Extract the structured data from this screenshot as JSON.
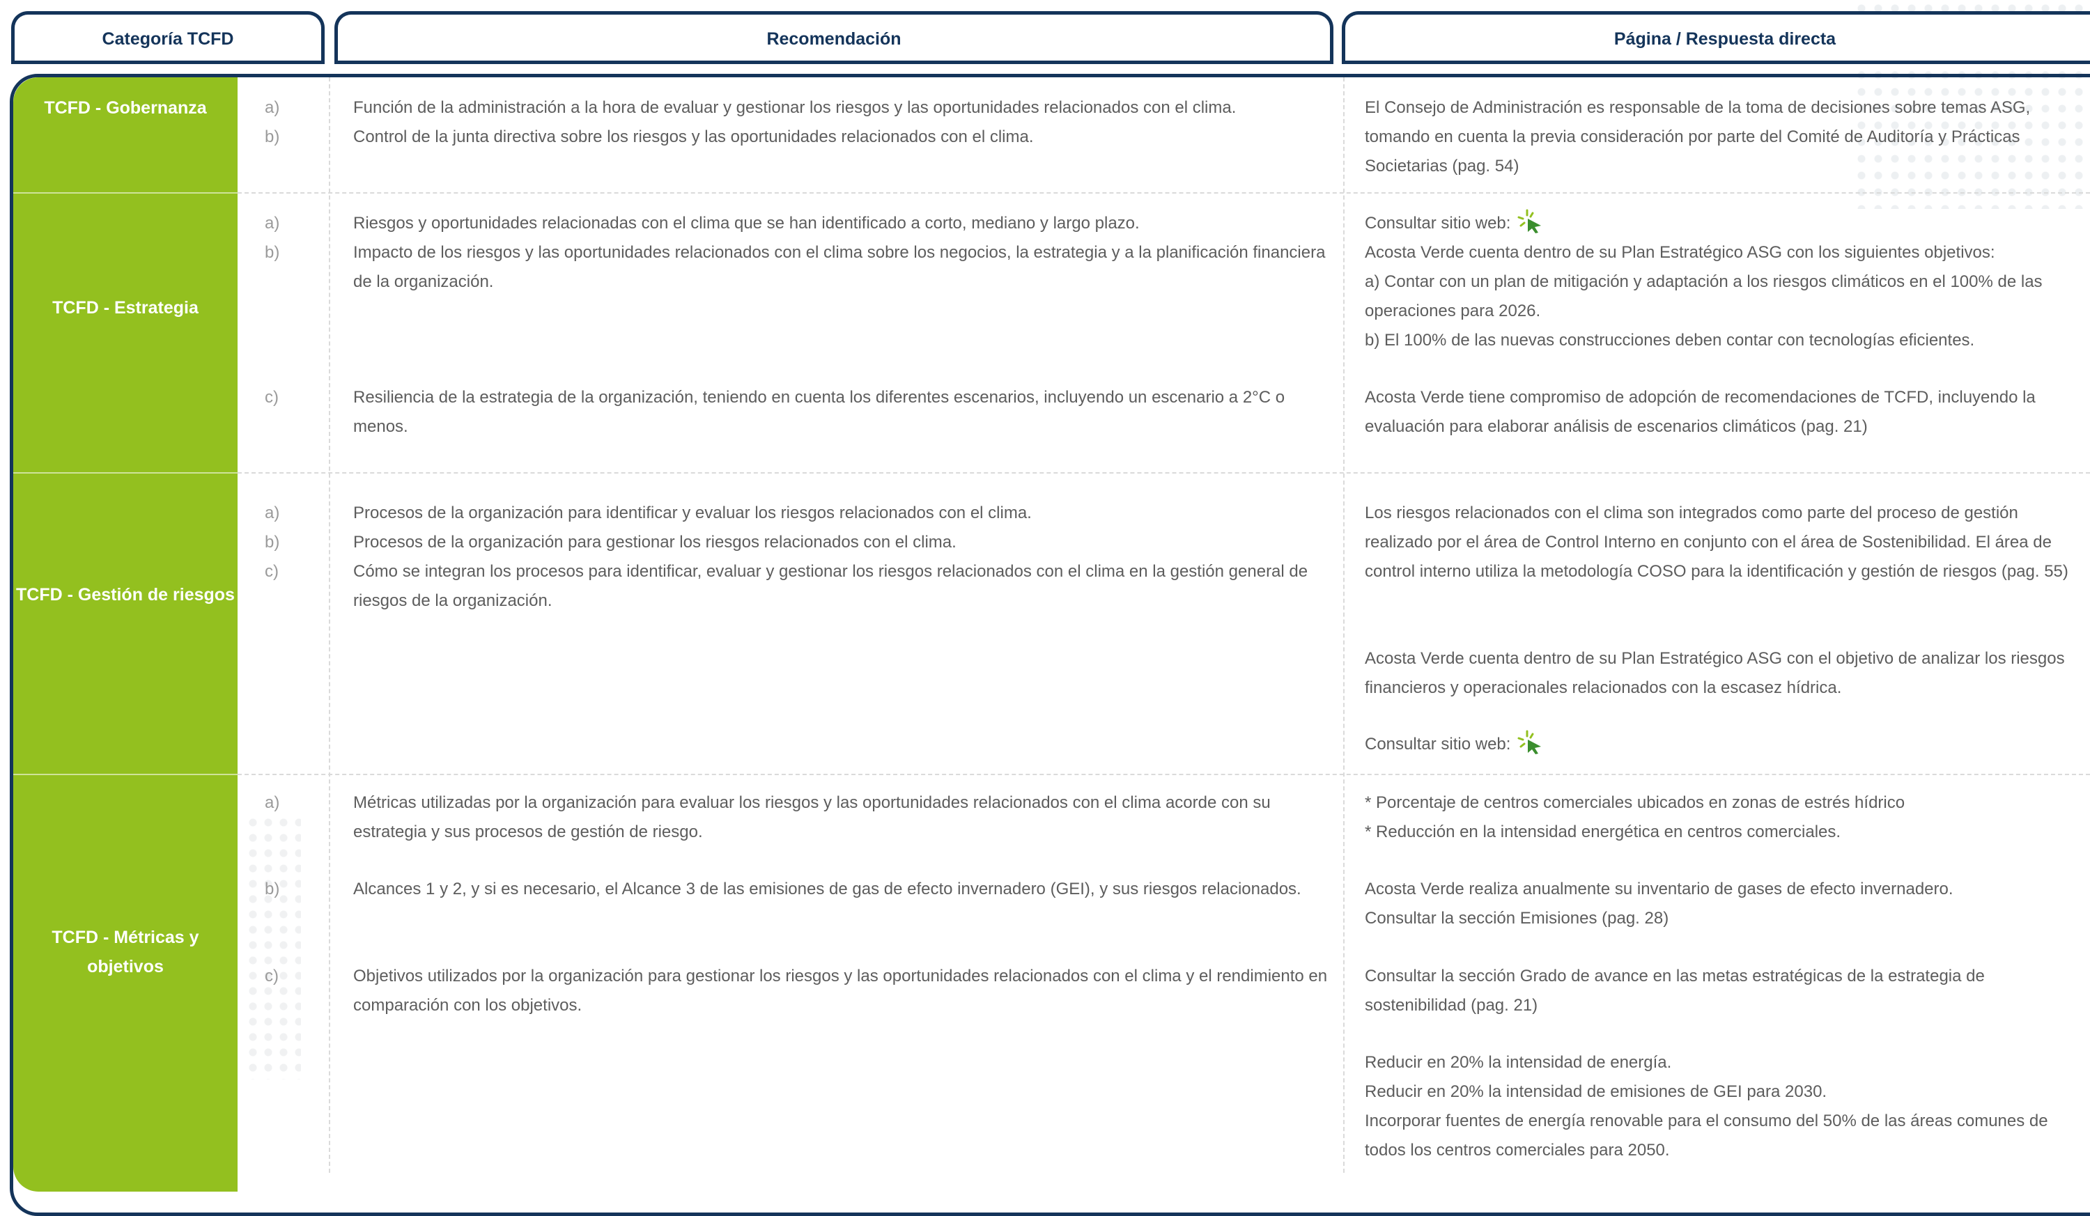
{
  "header": {
    "col1": "Categoría TCFD",
    "col2": "Recomendación",
    "col3": "Página / Respuesta directa"
  },
  "colors": {
    "navy": "#14345a",
    "green": "#93c01f",
    "text": "#5d5d5d"
  },
  "sections": [
    {
      "category": "TCFD - Gobernanza",
      "items": [
        {
          "letter": "a)",
          "text": "Función de la administración a la hora de evaluar y gestionar los riesgos y las oportunidades relacionados con el clima."
        },
        {
          "letter": "b)",
          "text": "Control de la junta directiva sobre los riesgos y las oportunidades relacionados con el clima."
        }
      ],
      "response": [
        "El Consejo de Administración es responsable de la toma de decisiones sobre temas ASG, tomando en cuenta la previa consideración por parte del Comité de Auditoría y Prácticas Societarias (pag. 54)"
      ]
    },
    {
      "category": "TCFD - Estrategia",
      "items": [
        {
          "letter": "a)",
          "text": "Riesgos y oportunidades relacionadas con el clima que se han identificado a corto, mediano y largo plazo."
        },
        {
          "letter": "b)",
          "text": "Impacto de los riesgos y las oportunidades relacionados con el clima sobre los negocios, la estrategia y a la planificación financiera de la organización."
        },
        {
          "letter": "c)",
          "text": "Resiliencia de la estrategia de la organización, teniendo en cuenta los diferentes escenarios, incluyendo un escenario a 2°C o menos."
        }
      ],
      "response": [
        "Consultar sitio web:",
        "Acosta Verde cuenta dentro de su Plan Estratégico ASG con los siguientes objetivos:",
        "a) Contar con un plan de mitigación y adaptación a los riesgos climáticos en el 100% de las operaciones para 2026.",
        "b) El 100% de las nuevas construcciones deben contar con tecnologías eficientes.",
        "Acosta Verde tiene compromiso de adopción de recomendaciones de TCFD, incluyendo la evaluación para elaborar análisis de escenarios climáticos (pag. 21)"
      ]
    },
    {
      "category": "TCFD - Gestión de riesgos",
      "items": [
        {
          "letter": "a)",
          "text": "Procesos de la organización para identificar y evaluar los riesgos relacionados con el clima."
        },
        {
          "letter": "b)",
          "text": "Procesos de la organización para gestionar los riesgos relacionados con el clima."
        },
        {
          "letter": "c)",
          "text": "Cómo se integran los procesos para identificar, evaluar y gestionar los riesgos relacionados con el clima en la gestión general de riesgos de la organización."
        }
      ],
      "response": [
        "Los riesgos relacionados con el clima son integrados como parte del proceso de gestión realizado por el área de Control Interno en conjunto con el área de Sostenibilidad. El área de control interno utiliza la metodología COSO para la identificación y gestión de riesgos (pag. 55)",
        "Acosta Verde cuenta dentro de su Plan Estratégico ASG con el  objetivo de analizar los riesgos financieros y operacionales relacionados con la escasez hídrica.",
        "Consultar sitio web:"
      ]
    },
    {
      "category": "TCFD - Métricas y objetivos",
      "items": [
        {
          "letter": "a)",
          "text": "Métricas utilizadas por la organización para evaluar los riesgos y las oportunidades relacionados con el clima acorde con su estrategia y sus procesos de gestión de riesgo."
        },
        {
          "letter": "b)",
          "text": "Alcances 1 y 2, y si es necesario, el Alcance 3 de las emisiones de gas de efecto invernadero (GEI), y sus riesgos relacionados."
        },
        {
          "letter": "c)",
          "text": "Objetivos utilizados por la organización para gestionar los riesgos y las oportunidades relacionados con el clima y el rendimiento en comparación con los objetivos."
        }
      ],
      "response": [
        "* Porcentaje de centros comerciales ubicados en zonas de estrés hídrico",
        "* Reducción en la intensidad energética en centros comerciales.",
        "Acosta Verde realiza anualmente su inventario de gases de efecto invernadero.",
        "Consultar la sección Emisiones (pag. 28)",
        "Consultar la sección Grado de avance en las metas estratégicas de la estrategia de sostenibilidad (pag. 21)",
        "Reducir en 20% la intensidad de energía.",
        "Reducir en 20% la intensidad de emisiones de GEI para 2030.",
        "Incorporar fuentes de energía renovable para el consumo del 50% de las áreas comunes de todos los centros comerciales para 2050."
      ]
    }
  ]
}
